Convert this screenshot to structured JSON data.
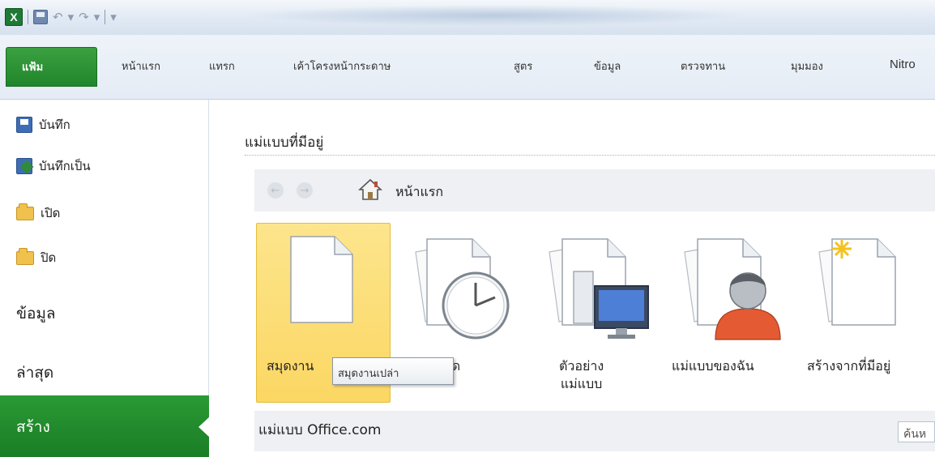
{
  "ribbon": {
    "tabs": [
      "แฟ้ม",
      "หน้าแรก",
      "แทรก",
      "เค้าโครงหน้ากระดาษ",
      "สูตร",
      "ข้อมูล",
      "ตรวจทาน",
      "มุมมอง",
      "Nitro"
    ]
  },
  "qat": {
    "app_icon": "X"
  },
  "leftnav": {
    "items": [
      "บันทึก",
      "บันทึกเป็น",
      "เปิด",
      "ปิด"
    ],
    "info": "ข้อมูล",
    "recent": "ล่าสุด",
    "new": "สร้าง"
  },
  "main": {
    "section_title": "แม่แบบที่มีอยู่",
    "home_label": "หน้าแรก",
    "tiles": [
      "สมุดงาน",
      "บล่าสุด",
      "ตัวอย่าง แม่แบบ",
      "แม่แบบของฉัน",
      "สร้างจากที่มีอยู่"
    ],
    "office_section": "แม่แบบ Office.com",
    "search_text": "ค้นห"
  },
  "tooltip": "สมุดงานเปล่า",
  "colors": {
    "file_tab": "#21862b",
    "nav_active": "#1a7d25",
    "selection": "#fbd763"
  }
}
